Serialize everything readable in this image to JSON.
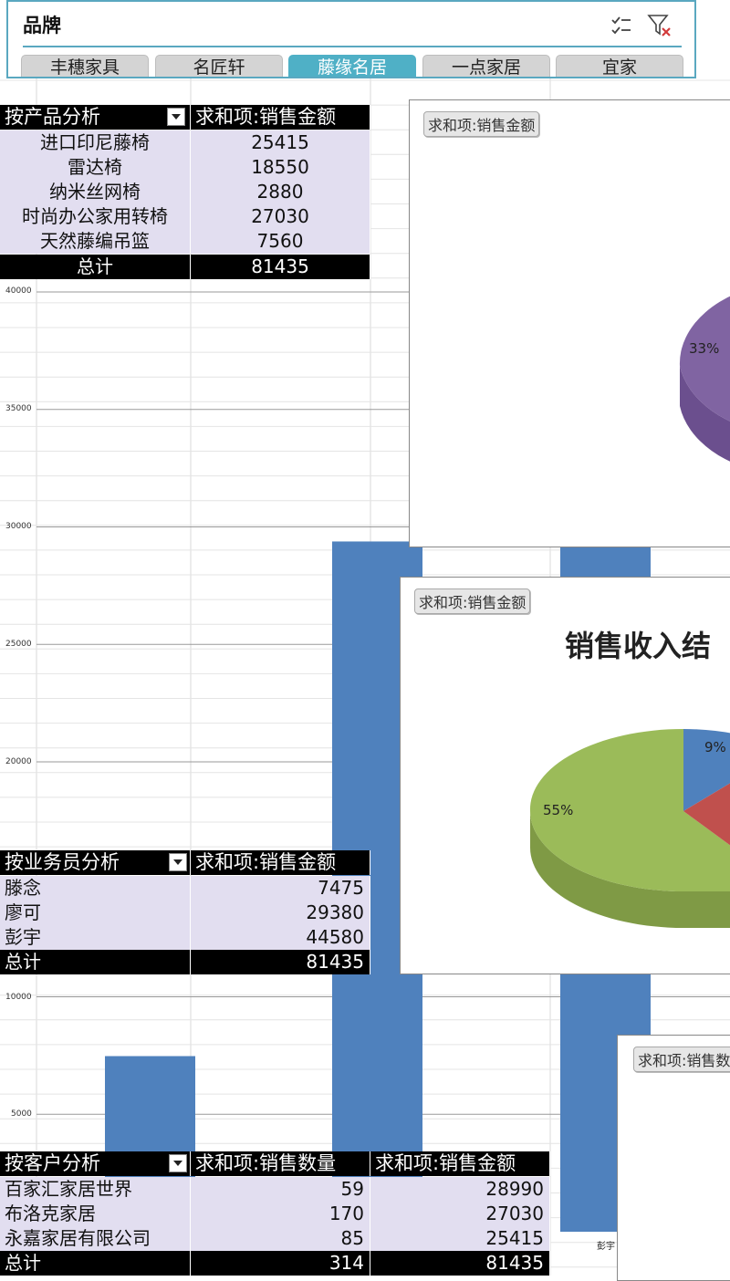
{
  "slicer": {
    "title": "品牌",
    "items": [
      "丰穗家具",
      "名匠轩",
      "藤缘名居",
      "一点家居",
      "宜家"
    ],
    "selected_index": 2,
    "multi_select_icon": "multi-select-icon",
    "clear_filter_icon": "clear-filter-icon",
    "accent_color": "#5aa8c0"
  },
  "product_table": {
    "header_row": "按产品分析",
    "header_value": "求和项:销售金额",
    "rows": [
      {
        "label": "进口印尼藤椅",
        "value": "25415"
      },
      {
        "label": "雷达椅",
        "value": "18550"
      },
      {
        "label": "纳米丝网椅",
        "value": "2880"
      },
      {
        "label": "时尚办公家用转椅",
        "value": "27030"
      },
      {
        "label": "天然藤编吊篮",
        "value": "7560"
      }
    ],
    "total_label": "总计",
    "total_value": "81435"
  },
  "salesperson_table": {
    "header_row": "按业务员分析",
    "header_value": "求和项:销售金额",
    "rows": [
      {
        "label": "滕念",
        "value": "7475"
      },
      {
        "label": "廖可",
        "value": "29380"
      },
      {
        "label": "彭宇",
        "value": "44580"
      }
    ],
    "total_label": "总计",
    "total_value": "81435"
  },
  "customer_table": {
    "header_row": "按客户分析",
    "header_qty": "求和项:销售数量",
    "header_value": "求和项:销售金额",
    "rows": [
      {
        "label": "百家汇家居世界",
        "qty": "59",
        "value": "28990"
      },
      {
        "label": "布洛克家居",
        "qty": "170",
        "value": "27030"
      },
      {
        "label": "永嘉家居有限公司",
        "qty": "85",
        "value": "25415"
      }
    ],
    "total_label": "总计",
    "total_qty": "314",
    "total_value": "81435"
  },
  "charts": {
    "pie1_field": "求和项:销售金额",
    "pie1_label": "33%",
    "pie2_field": "求和项:销售金额",
    "pie2_title": "销售收入结",
    "pie2_labels": [
      "9%",
      "55%"
    ],
    "pie3_field": "求和项:销售数",
    "bar_category_label": "彭宇"
  },
  "chart_data": [
    {
      "type": "bar",
      "categories": [
        "滕念",
        "廖可",
        "彭宇"
      ],
      "values": [
        7475,
        29380,
        44580
      ],
      "ylim": [
        0,
        40000
      ],
      "yticks": [
        "40000",
        "35000",
        "30000",
        "25000",
        "20000",
        "10000",
        "5000"
      ],
      "color": "#4f81bd"
    },
    {
      "type": "pie",
      "title": "销售收入结",
      "labels": [
        "9%",
        "55%"
      ],
      "colors": [
        "#4f81bd",
        "#c0504d",
        "#9bbb59"
      ]
    }
  ]
}
